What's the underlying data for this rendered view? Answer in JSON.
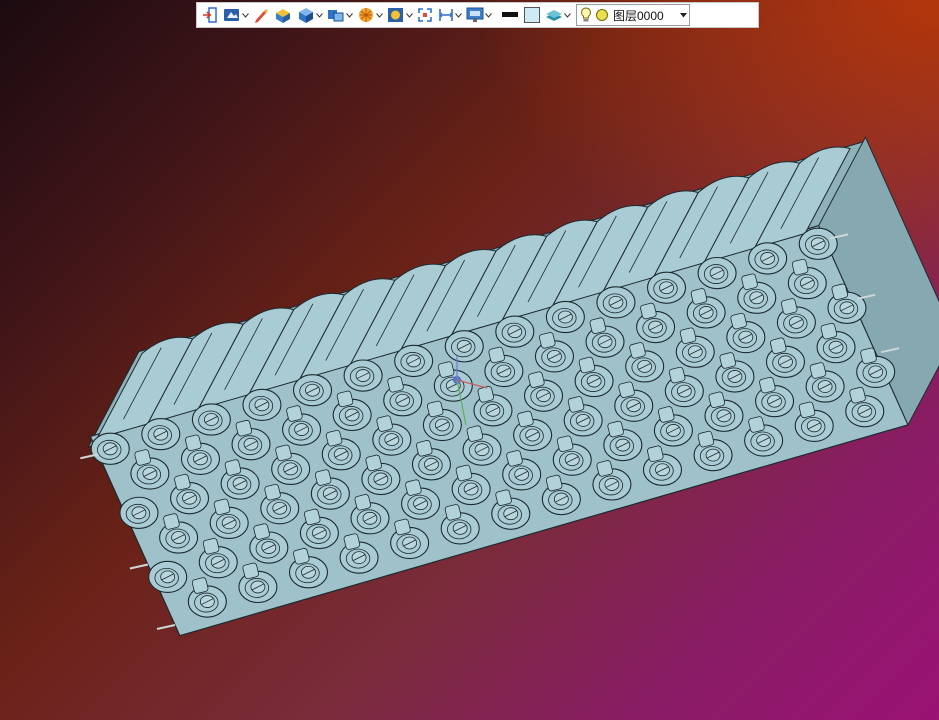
{
  "toolbar": {
    "buttons": [
      {
        "name": "exit-sketch-icon",
        "dropdown": false
      },
      {
        "name": "view-mode-icon",
        "dropdown": true
      },
      {
        "name": "pencil-icon",
        "dropdown": false
      },
      {
        "name": "shaded-box-icon",
        "dropdown": false
      },
      {
        "name": "solid-cube-icon",
        "dropdown": true
      },
      {
        "name": "display-style-icon",
        "dropdown": true
      },
      {
        "name": "render-sphere-icon",
        "dropdown": true
      },
      {
        "name": "zoom-fit-icon",
        "dropdown": true
      },
      {
        "name": "fit-frame-icon",
        "dropdown": false
      },
      {
        "name": "measure-icon",
        "dropdown": true
      },
      {
        "name": "screen-display-icon",
        "dropdown": true
      },
      {
        "name": "line-color-icon",
        "dropdown": false
      },
      {
        "name": "fill-color-icon",
        "dropdown": false
      },
      {
        "name": "layer-stack-icon",
        "dropdown": true
      }
    ],
    "layer": {
      "label": "图层0000",
      "bulb_icon": "lightbulb-icon",
      "state_icon": "layer-on-icon"
    }
  },
  "colors": {
    "model_fill": "#a9cbd3",
    "model_edge": "#1c2a30",
    "toolbar_bg": "#ffffff"
  }
}
